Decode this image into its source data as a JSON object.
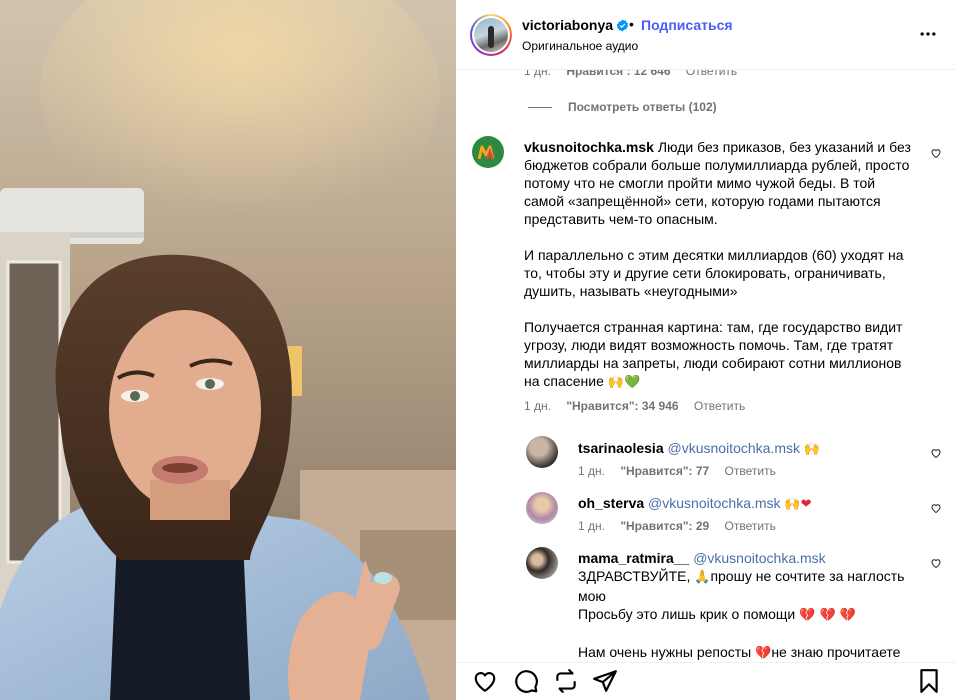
{
  "header": {
    "username": "victoriabonya",
    "dot": "•",
    "follow_label": "Подписаться",
    "audio_label": "Оригинальное аудио"
  },
  "prev_comment": {
    "time": "1 дн.",
    "likes": "Нравится : 12 646",
    "reply": "Ответить"
  },
  "view_replies_label": "Посмотреть ответы (102)",
  "main_comment": {
    "username": "vkusnoitochka.msk",
    "p1": "Люди без приказов, без указаний и без бюджетов собрали больше полумиллиарда рублей, просто потому что не смогли пройти мимо чужой беды. В той самой «запрещённой» сети, которую годами пытаются представить чем-то опасным.",
    "p2": "И параллельно с этим десятки миллиардов (60) уходят на то, чтобы эту и другие сети блокировать, ограничивать, душить, называть «неугодными»",
    "p3": "Получается странная картина: там, где государство видит угрозу, люди видят возможность помочь. Там, где тратят миллиарды на запреты, люди собирают сотни миллионов на спасение",
    "p3_emoji": "🙌",
    "p3_emoji2": "💚",
    "time": "1 дн.",
    "likes": "\"Нравится\": 34 946",
    "reply": "Ответить"
  },
  "replies": [
    {
      "username": "tsarinaolesia",
      "mention": "@vkusnoitochka.msk",
      "emoji": "🙌",
      "time": "1 дн.",
      "likes": "\"Нравится\": 77",
      "reply": "Ответить"
    },
    {
      "username": "oh_sterva",
      "mention": "@vkusnoitochka.msk",
      "emoji": "🙌",
      "emoji2": "❤",
      "time": "1 дн.",
      "likes": "\"Нравится\": 29",
      "reply": "Ответить"
    },
    {
      "username": "mama_ratmira__",
      "mention": "@vkusnoitochka.msk",
      "line1": "ЗДРАВСТВУЙТЕ,",
      "line1_emoji": "🙏",
      "line1_rest": "прошу не сочтите за наглость",
      "line2": "мою",
      "line3": "Просьбу это лишь крик о помощи",
      "line3_emoji": "💔 💔 💔",
      "line5": "Нам очень нужны репосты",
      "line5_emoji": "💔",
      "line5_rest": "не знаю прочитаете"
    }
  ],
  "colors": {
    "follow": "#4a5df9",
    "meta": "#737373",
    "mcdonalds_green": "#2d8a3e",
    "mcdonalds_yellow": "#f6a623"
  },
  "icons": {
    "like": "heart-icon",
    "comment": "comment-icon",
    "repost": "repost-icon",
    "share": "share-icon",
    "save": "bookmark-icon",
    "more": "more-icon"
  }
}
